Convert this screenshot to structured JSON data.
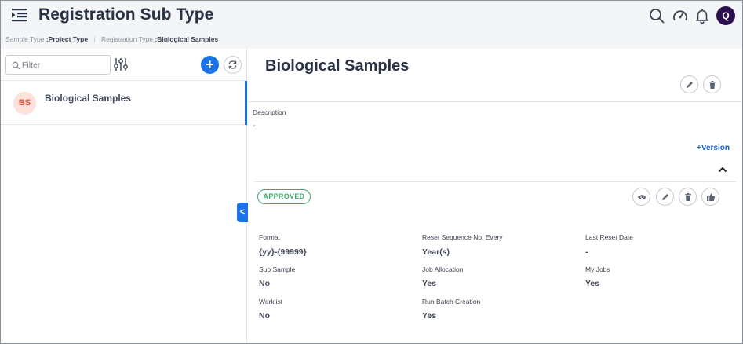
{
  "header": {
    "title": "Registration Sub Type",
    "avatar_initial": "Q",
    "icons": [
      "menu-collapse-icon",
      "search-icon",
      "dashboard-icon",
      "bell-icon"
    ]
  },
  "breadcrumb": [
    {
      "key": "Sample Type",
      "value": ":Project Type"
    },
    {
      "key": "Registration Type",
      "value": ":Biological Samples"
    }
  ],
  "sidebar": {
    "filter_placeholder": "Filter",
    "add_label": "+",
    "collapse_label": "<",
    "items": [
      {
        "initials": "BS",
        "label": "Biological Samples",
        "selected": true
      }
    ]
  },
  "detail": {
    "title": "Biological Samples",
    "description_label": "Description",
    "description_value": "-",
    "version_link": "Version",
    "status": "APPROVED",
    "fields": [
      {
        "label": "Format",
        "value": "{yy}-{99999}"
      },
      {
        "label": "Reset Sequence No. Every",
        "value": "Year(s)"
      },
      {
        "label": "Last Reset Date",
        "value": "-"
      },
      {
        "label": "Sub Sample",
        "value": "No"
      },
      {
        "label": "Job Allocation",
        "value": "Yes"
      },
      {
        "label": "My Jobs",
        "value": "Yes"
      },
      {
        "label": "Worklist",
        "value": "No"
      },
      {
        "label": "Run Batch Creation",
        "value": "Yes"
      }
    ]
  },
  "colors": {
    "primary": "#1a73e8",
    "status_green": "#3daa6d",
    "avatar_bg": "#2c0f4f",
    "item_avatar_bg": "#fde2dc",
    "item_avatar_text": "#e14d38"
  }
}
